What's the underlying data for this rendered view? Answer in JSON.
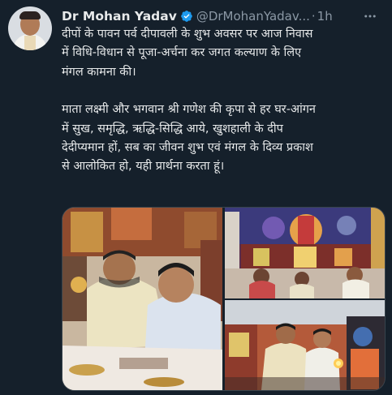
{
  "author": {
    "name": "Dr Mohan Yadav",
    "handle": "@DrMohanYadav...",
    "separator": "·",
    "time": "1h",
    "verified": true
  },
  "icons": {
    "verified": "verified-badge-icon",
    "more": "more-options-icon"
  },
  "tweet": {
    "paragraph_1": "दीपों के पावन पर्व दीपावली के शुभ अवसर पर आज निवास\nमें विधि-विधान से पूजा-अर्चना कर जगत कल्याण के लिए\nमंगल कामना की।",
    "paragraph_2": "माता लक्ष्मी और भगवान श्री गणेश की कृपा से हर घर-आंगन\nमें सुख, समृद्धि, ऋद्धि-सिद्धि आये, खुशहाली के दीप\nदेदीप्यमान हों, सब का जीवन शुभ एवं मंगल के दिव्य प्रकाश\nसे आलोकित हो, यही प्रार्थना करता हूं।"
  },
  "media": {
    "count": 3
  },
  "colors": {
    "background": "#15202b",
    "text": "#e7e9ea",
    "secondary": "#8b98a5",
    "verified": "#1d9bf0"
  }
}
